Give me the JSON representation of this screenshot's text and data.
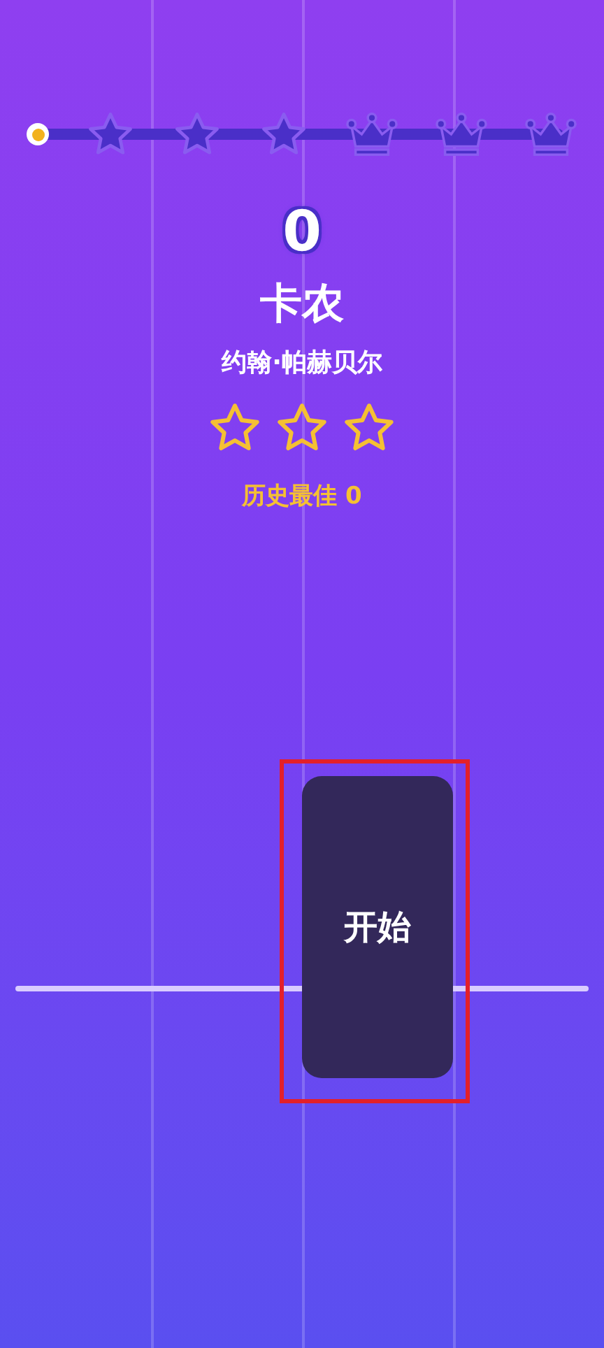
{
  "progress": {
    "milestones": [
      {
        "kind": "star"
      },
      {
        "kind": "star"
      },
      {
        "kind": "star"
      },
      {
        "kind": "crown"
      },
      {
        "kind": "crown"
      },
      {
        "kind": "crown"
      }
    ]
  },
  "score": "0",
  "song": {
    "title": "卡农",
    "artist": "约翰·帕赫贝尔"
  },
  "rating": {
    "stars": 0
  },
  "best": "历史最佳 0",
  "start_tile": {
    "label": "开始",
    "highlighted": true
  }
}
